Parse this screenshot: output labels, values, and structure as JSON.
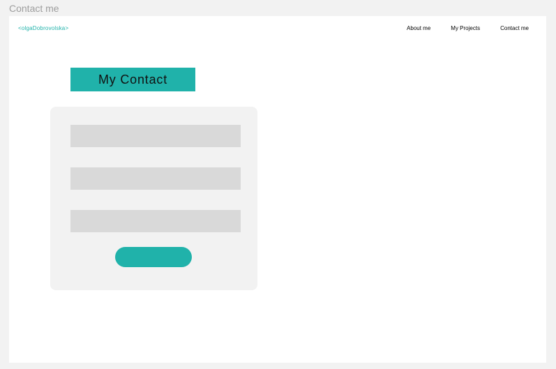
{
  "frame": {
    "title": "Contact me"
  },
  "header": {
    "logo": "<olgaDobrovolska>",
    "nav": {
      "about": "About me",
      "projects": "My Projects",
      "contact": "Contact me"
    }
  },
  "main": {
    "title": "My Contact",
    "form": {
      "name_value": "",
      "email_value": "",
      "message_value": "",
      "submit_label": ""
    }
  },
  "colors": {
    "accent": "#20b2aa",
    "field": "#d9d9d9",
    "card": "#f2f2f2",
    "background": "#ffffff"
  }
}
